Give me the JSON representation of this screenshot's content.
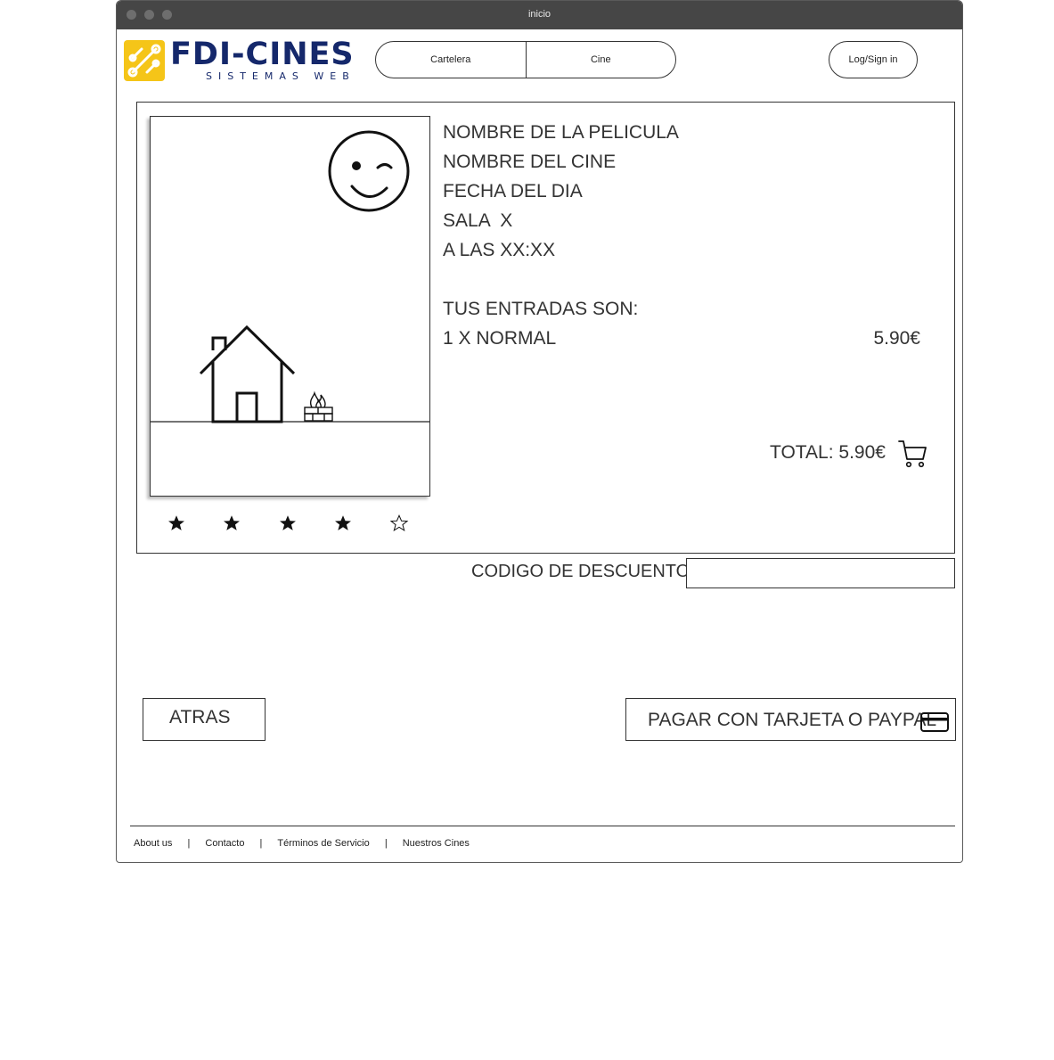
{
  "window": {
    "title": "inicio"
  },
  "header": {
    "logo": {
      "brand": "FDI-CINES",
      "tagline": "SISTEMAS WEB",
      "badge_color": "#f5c518",
      "brand_color": "#15286b"
    },
    "nav": [
      {
        "label": "Cartelera"
      },
      {
        "label": "Cine"
      }
    ],
    "login_label": "Log/Sign in"
  },
  "movie": {
    "poster": {
      "icons": [
        "wink-face-icon",
        "house-icon",
        "campfire-icon"
      ]
    },
    "rating": {
      "value": 4,
      "max": 5
    }
  },
  "summary": {
    "lines": [
      "NOMBRE DE LA PELICULA",
      "NOMBRE DEL CINE",
      "FECHA DEL DIA",
      "SALA  X",
      "A LAS XX:XX"
    ],
    "tickets_title": "TUS ENTRADAS SON:",
    "tickets": [
      {
        "label": "1 X NORMAL",
        "price": "5.90€"
      }
    ],
    "total_label": "TOTAL: 5.90€"
  },
  "discount": {
    "label": "CODIGO DE DESCUENTO :",
    "value": ""
  },
  "actions": {
    "back_label": "ATRAS",
    "pay_label": "PAGAR CON TARJETA O PAYPAL"
  },
  "footer": {
    "links": [
      {
        "label": "About us"
      },
      {
        "label": "Contacto"
      },
      {
        "label": "Términos de Servicio"
      },
      {
        "label": "Nuestros Cines"
      }
    ],
    "separator": "|"
  }
}
